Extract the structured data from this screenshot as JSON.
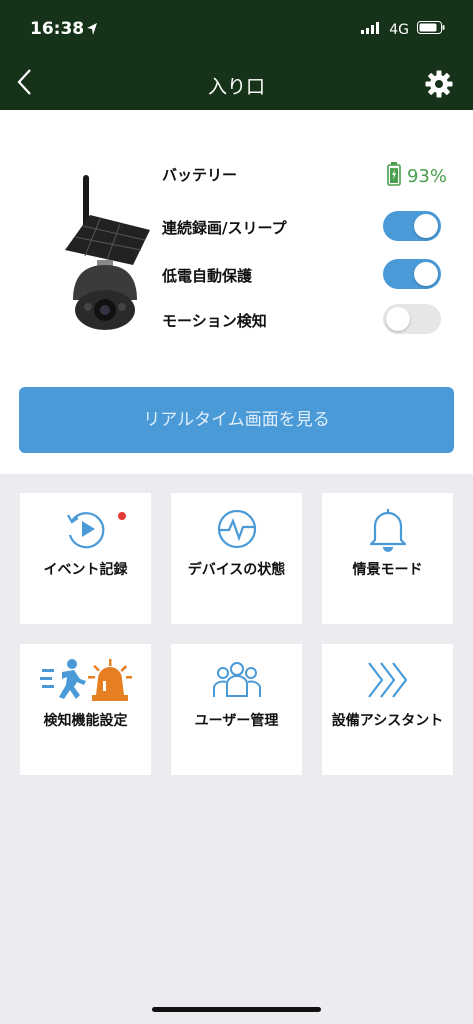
{
  "status": {
    "time": "16:38",
    "network": "4G"
  },
  "nav": {
    "title": "入り口"
  },
  "device": {
    "battery_label": "バッテリー",
    "battery_value": "93%",
    "battery_level": 0.93,
    "settings": [
      {
        "label": "連続録画/スリープ",
        "on": true
      },
      {
        "label": "低電自動保護",
        "on": true
      },
      {
        "label": "モーション検知",
        "on": false
      }
    ]
  },
  "live_button": "リアルタイム画面を見る",
  "tiles": [
    {
      "label": "イベント記録",
      "icon": "event-replay-icon",
      "badge": true
    },
    {
      "label": "デバイスの状態",
      "icon": "device-status-pulse-icon"
    },
    {
      "label": "情景モード",
      "icon": "bell-icon"
    },
    {
      "label": "検知機能設定",
      "icon": "motion-alarm-icon"
    },
    {
      "label": "ユーザー管理",
      "icon": "users-icon"
    },
    {
      "label": "設備アシスタント",
      "icon": "chevrons-right-icon"
    }
  ],
  "colors": {
    "header_bg": "#16331a",
    "accent": "#4a9ad8",
    "battery": "#4a9e4e",
    "badge": "#e53935",
    "orange": "#e67e22"
  }
}
